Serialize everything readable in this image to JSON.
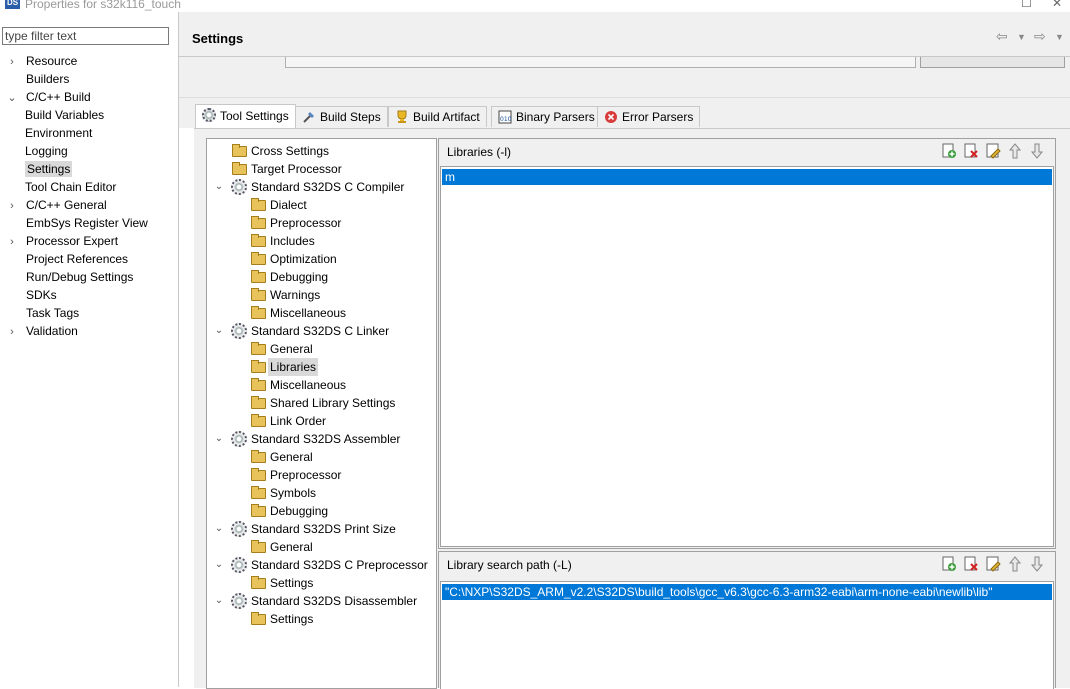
{
  "window": {
    "title": "Properties for s32k116_touch",
    "app_icon": "DS"
  },
  "filter": {
    "placeholder": "type filter text",
    "value": ""
  },
  "left_tree": [
    {
      "label": "Resource",
      "chevron": "›",
      "indent": 0,
      "selected": false
    },
    {
      "label": "Builders",
      "chevron": "",
      "indent": 0,
      "selected": false
    },
    {
      "label": "C/C++ Build",
      "chevron": "⌄",
      "indent": 0,
      "selected": false
    },
    {
      "label": "Build Variables",
      "chevron": "",
      "indent": 1,
      "selected": false
    },
    {
      "label": "Environment",
      "chevron": "",
      "indent": 1,
      "selected": false
    },
    {
      "label": "Logging",
      "chevron": "",
      "indent": 1,
      "selected": false
    },
    {
      "label": "Settings",
      "chevron": "",
      "indent": 1,
      "selected": true
    },
    {
      "label": "Tool Chain Editor",
      "chevron": "",
      "indent": 1,
      "selected": false
    },
    {
      "label": "C/C++ General",
      "chevron": "›",
      "indent": 0,
      "selected": false
    },
    {
      "label": "EmbSys Register View",
      "chevron": "",
      "indent": 0,
      "selected": false
    },
    {
      "label": "Processor Expert",
      "chevron": "›",
      "indent": 0,
      "selected": false
    },
    {
      "label": "Project References",
      "chevron": "",
      "indent": 0,
      "selected": false
    },
    {
      "label": "Run/Debug Settings",
      "chevron": "",
      "indent": 0,
      "selected": false
    },
    {
      "label": "SDKs",
      "chevron": "",
      "indent": 0,
      "selected": false
    },
    {
      "label": "Task Tags",
      "chevron": "",
      "indent": 0,
      "selected": false
    },
    {
      "label": "Validation",
      "chevron": "›",
      "indent": 0,
      "selected": false
    }
  ],
  "header": {
    "title": "Settings"
  },
  "tabs": [
    {
      "label": "Tool Settings",
      "icon": "gear-icon",
      "active": true
    },
    {
      "label": "Build Steps",
      "icon": "build-steps-icon",
      "active": false
    },
    {
      "label": "Build Artifact",
      "icon": "trophy-icon",
      "active": false
    },
    {
      "label": "Binary Parsers",
      "icon": "binary-icon",
      "active": false
    },
    {
      "label": "Error Parsers",
      "icon": "error-icon",
      "active": false
    }
  ],
  "tool_tree": [
    {
      "label": "Cross Settings",
      "type": "folder",
      "indent": 0,
      "expandable": false,
      "selected": false
    },
    {
      "label": "Target Processor",
      "type": "folder",
      "indent": 0,
      "expandable": false,
      "selected": false
    },
    {
      "label": "Standard S32DS C Compiler",
      "type": "tool",
      "indent": 0,
      "expandable": true,
      "selected": false
    },
    {
      "label": "Dialect",
      "type": "folder",
      "indent": 1,
      "expandable": false,
      "selected": false
    },
    {
      "label": "Preprocessor",
      "type": "folder",
      "indent": 1,
      "expandable": false,
      "selected": false
    },
    {
      "label": "Includes",
      "type": "folder",
      "indent": 1,
      "expandable": false,
      "selected": false
    },
    {
      "label": "Optimization",
      "type": "folder",
      "indent": 1,
      "expandable": false,
      "selected": false
    },
    {
      "label": "Debugging",
      "type": "folder",
      "indent": 1,
      "expandable": false,
      "selected": false
    },
    {
      "label": "Warnings",
      "type": "folder",
      "indent": 1,
      "expandable": false,
      "selected": false
    },
    {
      "label": "Miscellaneous",
      "type": "folder",
      "indent": 1,
      "expandable": false,
      "selected": false
    },
    {
      "label": "Standard S32DS C Linker",
      "type": "tool",
      "indent": 0,
      "expandable": true,
      "selected": false
    },
    {
      "label": "General",
      "type": "folder",
      "indent": 1,
      "expandable": false,
      "selected": false
    },
    {
      "label": "Libraries",
      "type": "folder",
      "indent": 1,
      "expandable": false,
      "selected": true
    },
    {
      "label": "Miscellaneous",
      "type": "folder",
      "indent": 1,
      "expandable": false,
      "selected": false
    },
    {
      "label": "Shared Library Settings",
      "type": "folder",
      "indent": 1,
      "expandable": false,
      "selected": false
    },
    {
      "label": "Link Order",
      "type": "folder",
      "indent": 1,
      "expandable": false,
      "selected": false
    },
    {
      "label": "Standard S32DS Assembler",
      "type": "tool",
      "indent": 0,
      "expandable": true,
      "selected": false
    },
    {
      "label": "General",
      "type": "folder",
      "indent": 1,
      "expandable": false,
      "selected": false
    },
    {
      "label": "Preprocessor",
      "type": "folder",
      "indent": 1,
      "expandable": false,
      "selected": false
    },
    {
      "label": "Symbols",
      "type": "folder",
      "indent": 1,
      "expandable": false,
      "selected": false
    },
    {
      "label": "Debugging",
      "type": "folder",
      "indent": 1,
      "expandable": false,
      "selected": false
    },
    {
      "label": "Standard S32DS Print Size",
      "type": "tool",
      "indent": 0,
      "expandable": true,
      "selected": false
    },
    {
      "label": "General",
      "type": "folder",
      "indent": 1,
      "expandable": false,
      "selected": false
    },
    {
      "label": "Standard S32DS C Preprocessor",
      "type": "tool",
      "indent": 0,
      "expandable": true,
      "selected": false
    },
    {
      "label": "Settings",
      "type": "folder",
      "indent": 1,
      "expandable": false,
      "selected": false
    },
    {
      "label": "Standard S32DS Disassembler",
      "type": "tool",
      "indent": 0,
      "expandable": true,
      "selected": false
    },
    {
      "label": "Settings",
      "type": "folder",
      "indent": 1,
      "expandable": false,
      "selected": false
    }
  ],
  "libraries": {
    "title": "Libraries (-l)",
    "items": [
      "m"
    ],
    "toolbar_icons": [
      "add-icon",
      "delete-icon",
      "edit-icon",
      "move-up-icon",
      "move-down-icon"
    ]
  },
  "search_path": {
    "title": "Library search path (-L)",
    "items": [
      "\"C:\\NXP\\S32DS_ARM_v2.2\\S32DS\\build_tools\\gcc_v6.3\\gcc-6.3-arm32-eabi\\arm-none-eabi\\newlib\\lib\""
    ],
    "toolbar_icons": [
      "add-icon",
      "delete-icon",
      "edit-icon",
      "move-up-icon",
      "move-down-icon"
    ]
  },
  "colors": {
    "selection": "#0078d7",
    "panel_bg": "#f0f0f0",
    "tree_selected": "#d9d9d9"
  }
}
